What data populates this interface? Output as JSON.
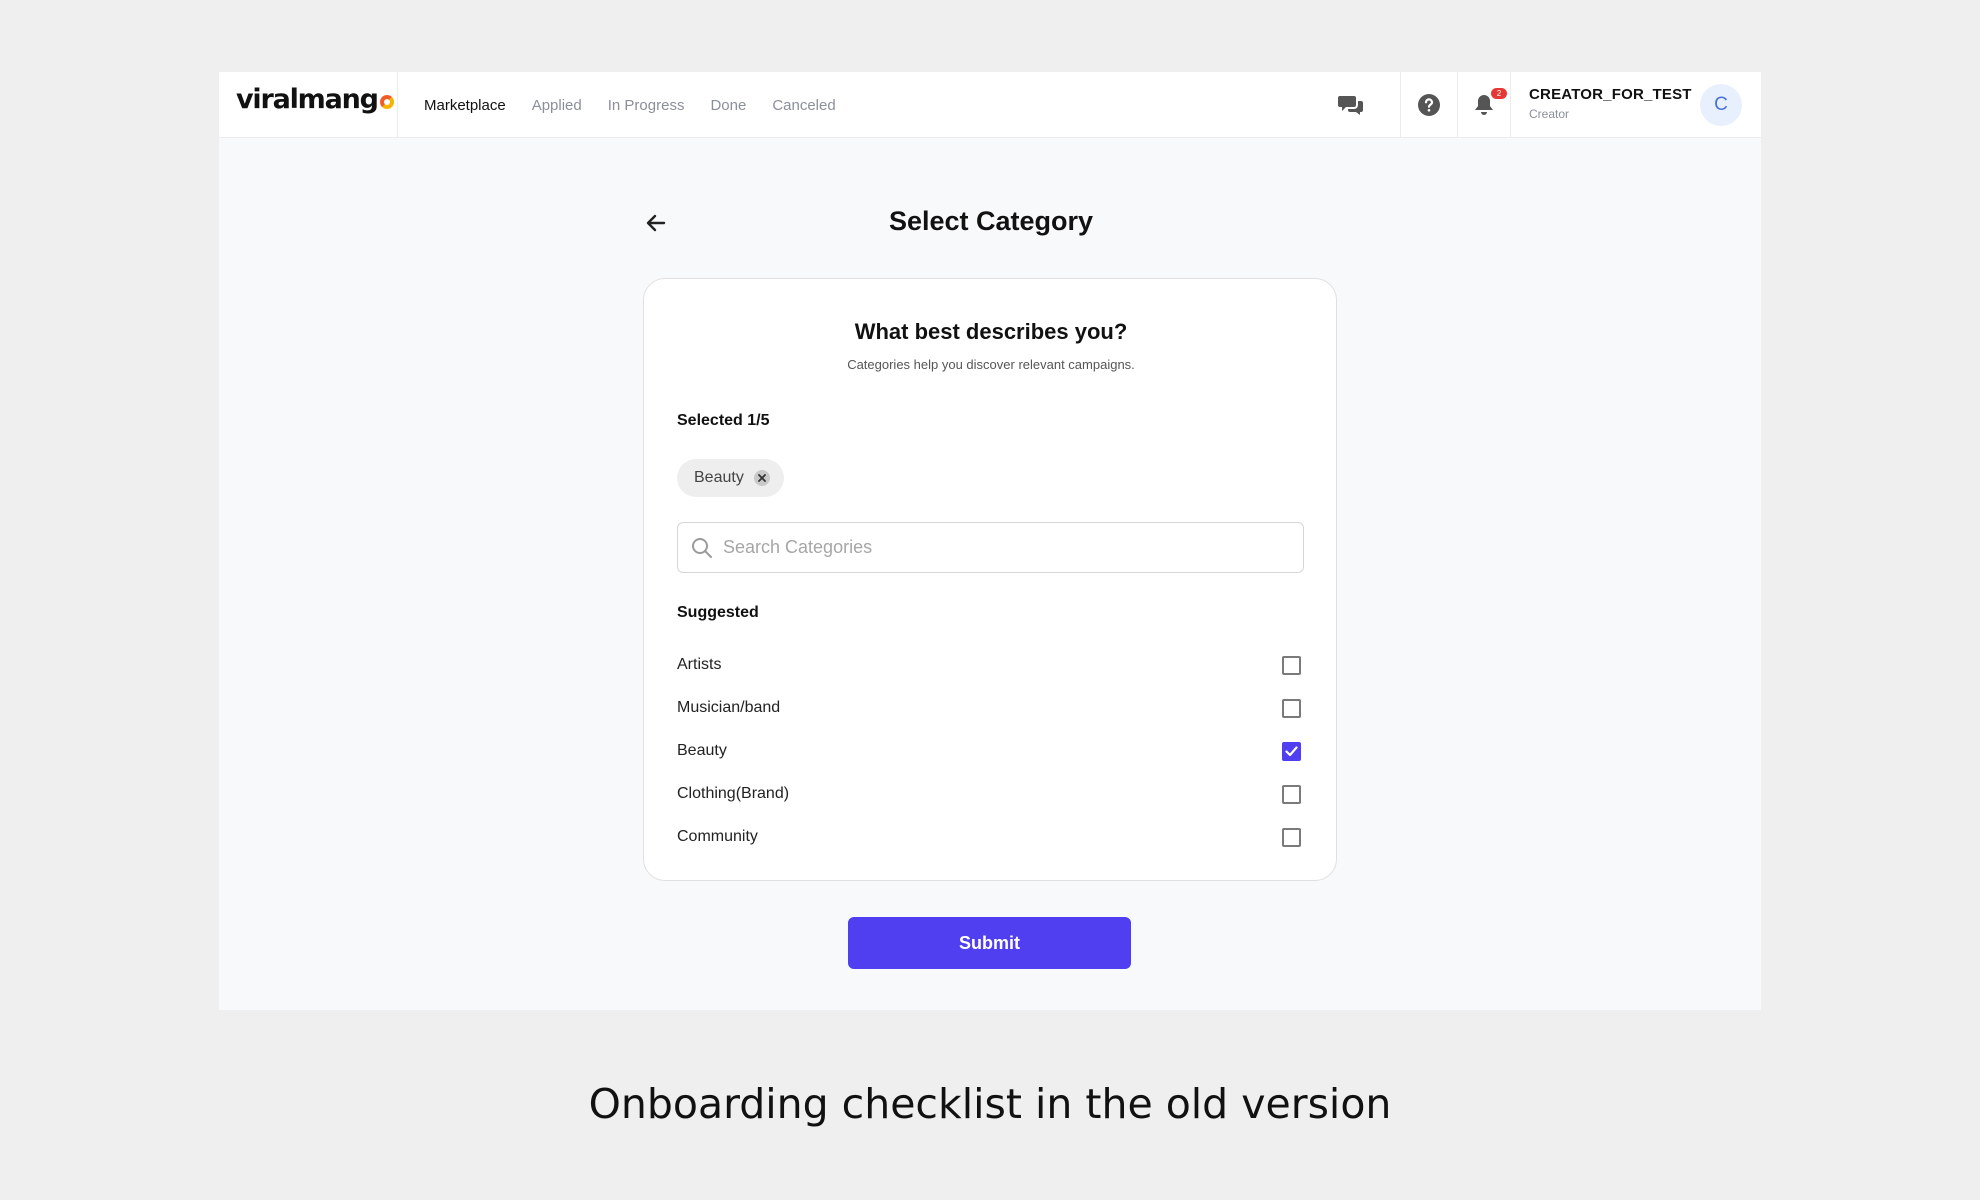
{
  "brand": {
    "logo_text": "viralmang",
    "logo_colors": [
      "#f25c2b",
      "#f6b400"
    ]
  },
  "nav": {
    "items": [
      {
        "label": "Marketplace",
        "active": true
      },
      {
        "label": "Applied",
        "active": false
      },
      {
        "label": "In Progress",
        "active": false
      },
      {
        "label": "Done",
        "active": false
      },
      {
        "label": "Canceled",
        "active": false
      }
    ]
  },
  "header_icons": {
    "chat": "chat-bubbles-icon",
    "help": "question-circle-icon",
    "notifications": "bell-icon",
    "notification_count": "2"
  },
  "user": {
    "name": "CREATOR_FOR_TEST",
    "role": "Creator",
    "avatar_initial": "C"
  },
  "page": {
    "title": "Select Category"
  },
  "card": {
    "title": "What best describes you?",
    "subtitle": "Categories help you discover relevant campaigns.",
    "selected_label": "Selected 1/5",
    "selected_chips": [
      {
        "label": "Beauty"
      }
    ],
    "search": {
      "placeholder": "Search Categories",
      "value": ""
    },
    "suggested_label": "Suggested",
    "suggested": [
      {
        "label": "Artists",
        "checked": false
      },
      {
        "label": "Musician/band",
        "checked": false
      },
      {
        "label": "Beauty",
        "checked": true
      },
      {
        "label": "Clothing(Brand)",
        "checked": false
      },
      {
        "label": "Community",
        "checked": false
      }
    ]
  },
  "submit_label": "Submit",
  "caption": "Onboarding checklist in the old version",
  "colors": {
    "accent": "#4f3ff0",
    "badge": "#e53935",
    "avatar_bg": "#e8f0fd"
  }
}
